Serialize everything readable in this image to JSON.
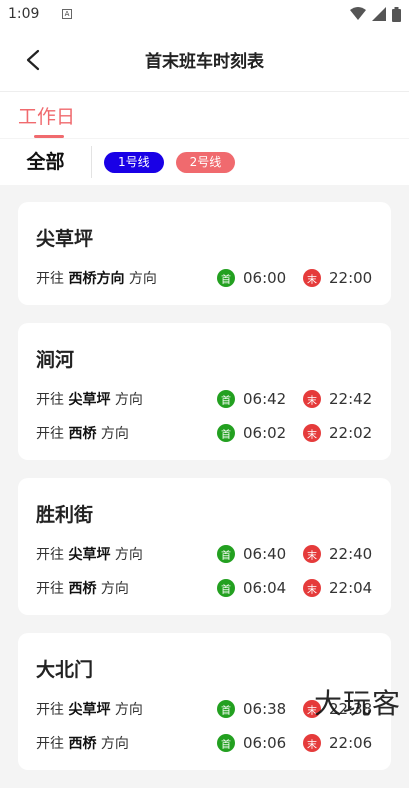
{
  "status_bar": {
    "time": "1:09",
    "notif": "A"
  },
  "header": {
    "title": "首末班车时刻表"
  },
  "tabs": [
    {
      "label": "工作日"
    }
  ],
  "filter": {
    "all_label": "全部",
    "chips": [
      {
        "label": "1号线",
        "color": "#1900e6"
      },
      {
        "label": "2号线",
        "color": "#f06a6e"
      }
    ]
  },
  "direction_prefix": "开往",
  "direction_suffix": "方向",
  "first_label": "首",
  "last_label": "末",
  "stations": [
    {
      "name": "尖草坪",
      "rows": [
        {
          "dest": "西桥方向",
          "first": "06:00",
          "last": "22:00"
        }
      ]
    },
    {
      "name": "涧河",
      "rows": [
        {
          "dest": "尖草坪",
          "first": "06:42",
          "last": "22:42"
        },
        {
          "dest": "西桥",
          "first": "06:02",
          "last": "22:02"
        }
      ]
    },
    {
      "name": "胜利街",
      "rows": [
        {
          "dest": "尖草坪",
          "first": "06:40",
          "last": "22:40"
        },
        {
          "dest": "西桥",
          "first": "06:04",
          "last": "22:04"
        }
      ]
    },
    {
      "name": "大北门",
      "rows": [
        {
          "dest": "尖草坪",
          "first": "06:38",
          "last": "22:38"
        },
        {
          "dest": "西桥",
          "first": "06:06",
          "last": "22:06"
        }
      ]
    }
  ],
  "watermark": "大玩客"
}
